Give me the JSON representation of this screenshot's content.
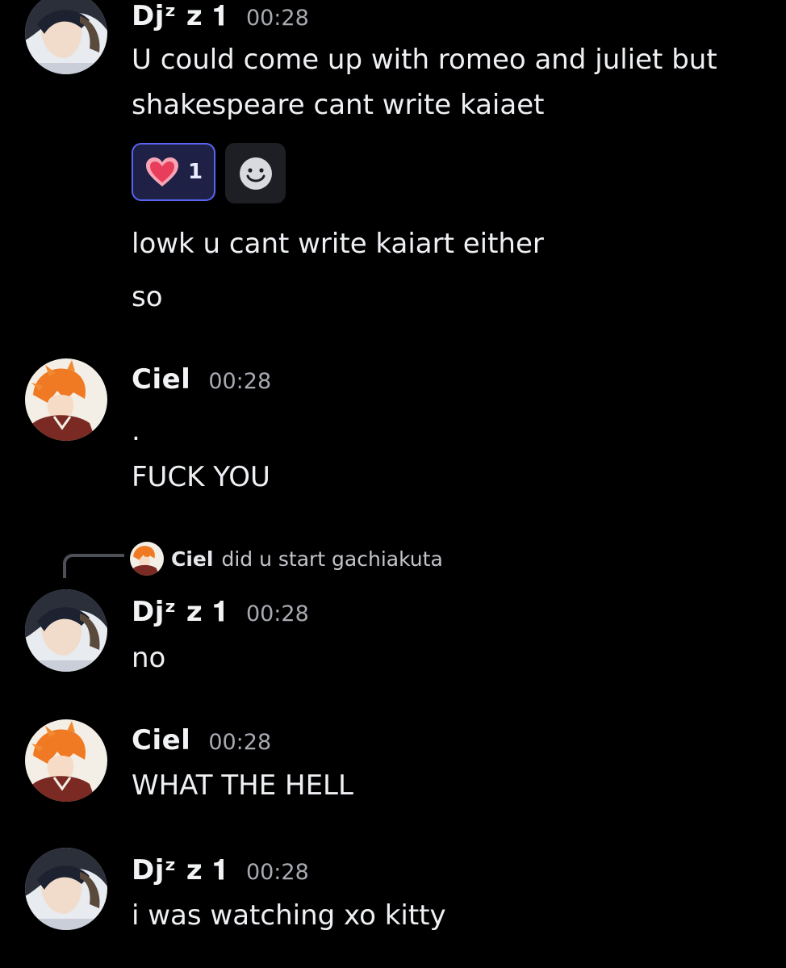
{
  "messages": [
    {
      "author": "Djᶻ z 𝟏",
      "time": "00:28",
      "lines": [
        "U could come up with romeo and juliet but",
        "shakespeare cant write kaiaet"
      ],
      "reaction": {
        "emoji": "heart-icon",
        "count": "1"
      },
      "followups": [
        "lowk u cant write kaiart either",
        "so"
      ]
    },
    {
      "author": "Ciel",
      "time": "00:28",
      "lines": [
        ".",
        "FUCK YOU"
      ]
    },
    {
      "reply_to": {
        "author": "Ciel",
        "text": "did u start gachiakuta"
      },
      "author": "Djᶻ z 𝟏",
      "time": "00:28",
      "lines": [
        "no"
      ]
    },
    {
      "author": "Ciel",
      "time": "00:28",
      "lines": [
        "WHAT THE HELL"
      ]
    },
    {
      "author": "Djᶻ z 𝟏",
      "time": "00:28",
      "lines": [
        "i was watching xo kitty"
      ]
    }
  ],
  "colors": {
    "background": "#000000",
    "reaction_border": "#5865f2",
    "reaction_bg": "#1e2046",
    "timestamp": "#a8aab1"
  }
}
